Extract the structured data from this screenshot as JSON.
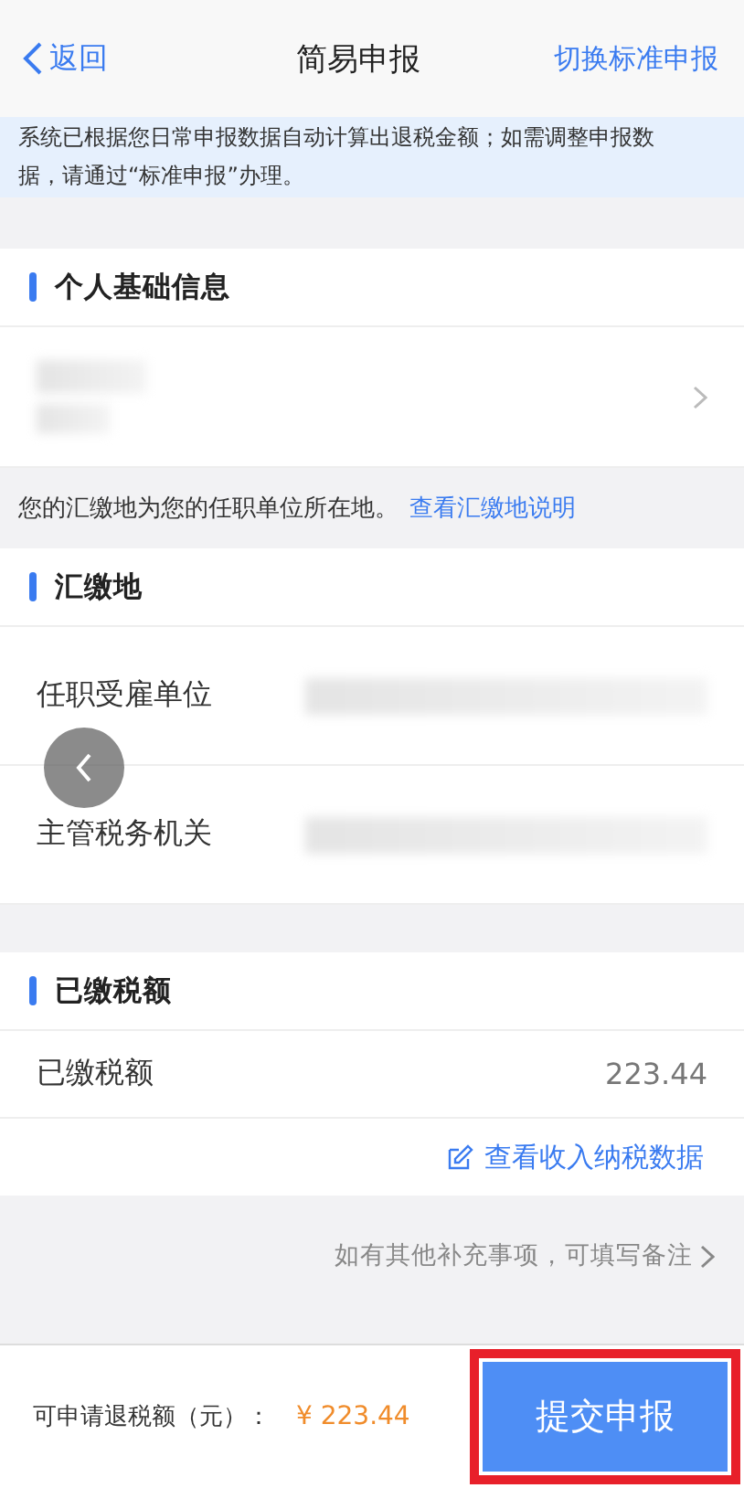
{
  "nav": {
    "back": "返回",
    "title": "简易申报",
    "action": "切换标准申报"
  },
  "notice": "系统已根据您日常申报数据自动计算出退税金额；如需调整申报数据，请通过“标准申报”办理。",
  "personal": {
    "title": "个人基础信息"
  },
  "location_note": {
    "text": "您的汇缴地为您的任职单位所在地。",
    "link": "查看汇缴地说明"
  },
  "location": {
    "title": "汇缴地",
    "rows": [
      {
        "label": "任职受雇单位"
      },
      {
        "label": "主管税务机关"
      }
    ]
  },
  "tax": {
    "title": "已缴税额",
    "rows": [
      {
        "label": "已缴税额",
        "value": "223.44"
      }
    ],
    "link": "查看收入纳税数据"
  },
  "remark": "如有其他补充事项，可填写备注",
  "footer": {
    "label": "可申请退税额（元）：",
    "amount": "¥ 223.44",
    "button": "提交申报",
    "highlighted": true
  }
}
